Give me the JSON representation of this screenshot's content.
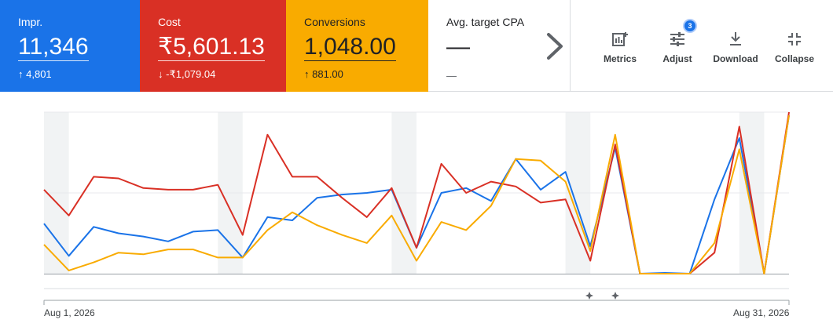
{
  "metrics": [
    {
      "label": "Impr.",
      "value": "11,346",
      "delta_arrow": "↑",
      "delta": "4,801"
    },
    {
      "label": "Cost",
      "value": "₹5,601.13",
      "delta_arrow": "↓",
      "delta": "-₹1,079.04"
    },
    {
      "label": "Conversions",
      "value": "1,048.00",
      "delta_arrow": "↑",
      "delta": "881.00"
    },
    {
      "label": "Avg. target CPA",
      "value": "—",
      "delta": "—"
    }
  ],
  "colors": {
    "impr": "#1a73e8",
    "cost": "#d93025",
    "conversions": "#f9ab00"
  },
  "toolbar": {
    "metrics_label": "Metrics",
    "adjust_label": "Adjust",
    "adjust_badge": "3",
    "download_label": "Download",
    "collapse_label": "Collapse"
  },
  "chart_data": {
    "type": "line",
    "x_start_label": "Aug 1, 2026",
    "x_end_label": "Aug 31, 2026",
    "x": [
      "Aug 1",
      "Aug 2",
      "Aug 3",
      "Aug 4",
      "Aug 5",
      "Aug 6",
      "Aug 7",
      "Aug 8",
      "Aug 9",
      "Aug 10",
      "Aug 11",
      "Aug 12",
      "Aug 13",
      "Aug 14",
      "Aug 15",
      "Aug 16",
      "Aug 17",
      "Aug 18",
      "Aug 19",
      "Aug 20",
      "Aug 21",
      "Aug 22",
      "Aug 23",
      "Aug 24",
      "Aug 25",
      "Aug 26",
      "Aug 27",
      "Aug 28",
      "Aug 29",
      "Aug 30",
      "Aug 31"
    ],
    "weekend_bands": [
      [
        0,
        1
      ],
      [
        7,
        8
      ],
      [
        14,
        15
      ],
      [
        21,
        22
      ],
      [
        28,
        29
      ]
    ],
    "ylim": [
      0,
      100
    ],
    "grid": true,
    "series": [
      {
        "name": "Impr.",
        "color": "#1a73e8",
        "values": [
          31,
          11,
          29,
          25,
          23,
          20,
          26,
          27,
          10,
          35,
          33,
          47,
          49,
          50,
          52,
          16,
          50,
          53,
          45,
          71,
          52,
          63,
          17,
          78,
          0,
          0.5,
          0,
          46,
          84,
          0,
          98
        ]
      },
      {
        "name": "Cost",
        "color": "#d93025",
        "values": [
          52,
          36,
          60,
          59,
          53,
          52,
          52,
          55,
          24,
          86,
          60,
          60,
          47,
          35,
          53,
          16,
          68,
          50,
          57,
          54,
          44,
          46,
          8,
          80,
          0,
          0,
          0,
          13,
          91,
          0,
          100
        ]
      },
      {
        "name": "Conversions",
        "color": "#f9ab00",
        "values": [
          18,
          2,
          7,
          13,
          12,
          15,
          15,
          10,
          10,
          27,
          38,
          30,
          24,
          19,
          36,
          8,
          32,
          27,
          42,
          71,
          70,
          57,
          14,
          86,
          0,
          0,
          0,
          19,
          77,
          0,
          98
        ]
      }
    ]
  }
}
